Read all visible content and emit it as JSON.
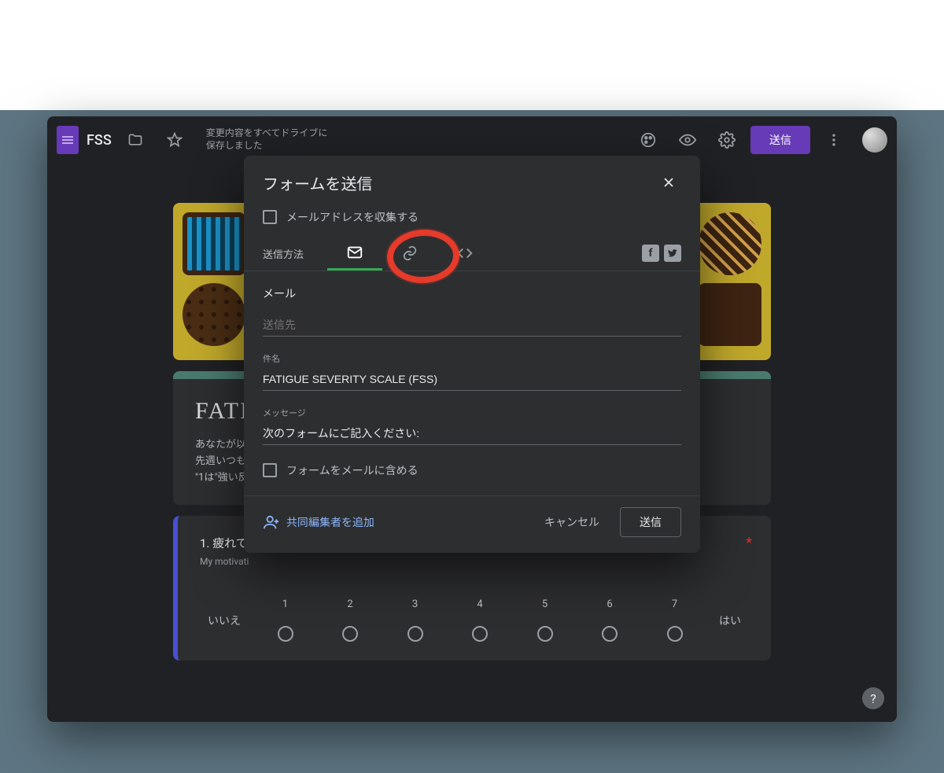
{
  "header": {
    "doc_title": "FSS",
    "save_status_line1": "変更内容をすべてドライブに",
    "save_status_line2": "保存しました",
    "send_button": "送信"
  },
  "form": {
    "title": "FATIG",
    "desc_line1": "あなたが以",
    "desc_line2": "先週いつも",
    "desc_line3": "\"1は\"強い反",
    "question1_title": "1. 疲れてい",
    "question1_sub": "My motivati",
    "scale_left": "いいえ",
    "scale_right": "はい",
    "scale_numbers": [
      "1",
      "2",
      "3",
      "4",
      "5",
      "6",
      "7"
    ]
  },
  "modal": {
    "title": "フォームを送信",
    "collect_email_label": "メールアドレスを収集する",
    "tabs_label": "送信方法",
    "mail_section": "メール",
    "recipient_label": "送信先",
    "recipient_value": "",
    "subject_label": "件名",
    "subject_value": "FATIGUE SEVERITY SCALE (FSS)",
    "message_label": "メッセージ",
    "message_value": "次のフォームにご記入ください:",
    "include_form_label": "フォームをメールに含める",
    "add_collaborators": "共同編集者を追加",
    "cancel_button": "キャンセル",
    "send_button": "送信"
  }
}
